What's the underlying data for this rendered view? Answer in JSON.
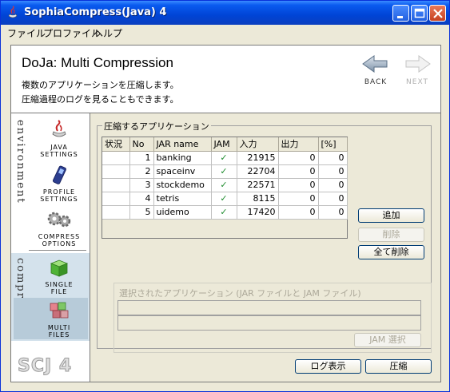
{
  "window": {
    "title": "SophiaCompress(Java) 4"
  },
  "menu": [
    "ファイル",
    "プロファイル",
    "ヘルプ"
  ],
  "header": {
    "title": "DoJa: Multi Compression",
    "description_line1": "複数のアプリケーションを圧縮します。",
    "description_line2": "圧縮過程のログを見ることもできます。",
    "back_label": "BACK",
    "next_label": "NEXT"
  },
  "sidebar": {
    "environment_label": "environment",
    "compress_label": "compress",
    "items": [
      {
        "line1": "JAVA",
        "line2": "SETTINGS",
        "icon": "java-cup-icon"
      },
      {
        "line1": "PROFILE",
        "line2": "SETTINGS",
        "icon": "phone-icon"
      },
      {
        "line1": "COMPRESS",
        "line2": "OPTIONS",
        "icon": "gears-icon"
      },
      {
        "line1": "SINGLE",
        "line2": "FILE",
        "icon": "green-box-icon"
      },
      {
        "line1": "MULTI",
        "line2": "FILES",
        "icon": "multi-box-icon"
      }
    ],
    "logo": "SCJ 4"
  },
  "apps_group": {
    "label": "圧縮するアプリケーション",
    "columns": [
      "状況",
      "No",
      "JAR name",
      "JAM",
      "入力",
      "出力",
      "[%]"
    ],
    "rows": [
      {
        "status": "",
        "no": "1",
        "jar": "banking",
        "jam": "✓",
        "input": "21915",
        "output": "0",
        "pct": "0"
      },
      {
        "status": "",
        "no": "2",
        "jar": "spaceinv",
        "jam": "✓",
        "input": "22704",
        "output": "0",
        "pct": "0"
      },
      {
        "status": "",
        "no": "3",
        "jar": "stockdemo",
        "jam": "✓",
        "input": "22571",
        "output": "0",
        "pct": "0"
      },
      {
        "status": "",
        "no": "4",
        "jar": "tetris",
        "jam": "✓",
        "input": "8115",
        "output": "0",
        "pct": "0"
      },
      {
        "status": "",
        "no": "5",
        "jar": "uidemo",
        "jam": "✓",
        "input": "17420",
        "output": "0",
        "pct": "0"
      }
    ],
    "add_label": "追加",
    "delete_label": "削除",
    "delete_all_label": "全て削除"
  },
  "selected_group": {
    "label": "選択されたアプリケーション (JAR ファイルと JAM ファイル)",
    "jam_select_label": "JAM 選択"
  },
  "footer": {
    "log_label": "ログ表示",
    "compress_label": "圧縮"
  }
}
